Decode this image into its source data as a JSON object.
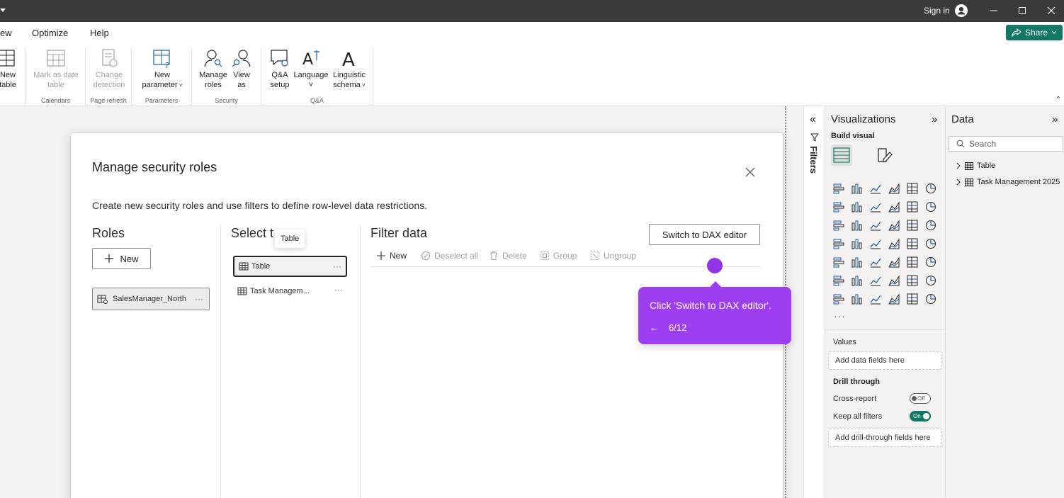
{
  "titlebar": {
    "signin": "Sign in"
  },
  "ribbon": {
    "tabs": [
      "ew",
      "Optimize",
      "Help"
    ],
    "share_label": "Share",
    "groups": {
      "calc": {
        "new_table": [
          "New",
          "table"
        ]
      },
      "calendars": {
        "mark_date": [
          "Mark as date",
          "table"
        ],
        "label": "Calendars"
      },
      "page_refresh": {
        "change_detection": [
          "Change",
          "detection"
        ],
        "label": "Page refresh"
      },
      "parameters": {
        "new_parameter": [
          "New",
          "parameter"
        ],
        "label": "Parameters"
      },
      "security": {
        "manage_roles": [
          "Manage",
          "roles"
        ],
        "view_as": [
          "View",
          "as"
        ],
        "label": "Security"
      },
      "qa": {
        "qa_setup": [
          "Q&A",
          "setup"
        ],
        "language": [
          "Language",
          "˅"
        ],
        "linguistic": [
          "Linguistic",
          "schema"
        ],
        "label": "Q&A"
      }
    }
  },
  "modal": {
    "title": "Manage security roles",
    "description": "Create new security roles and use filters to define row-level data restrictions.",
    "roles_title": "Roles",
    "new_label": "New",
    "roles": [
      {
        "name": "SalesManager_North"
      }
    ],
    "select_table_title": "Select t",
    "tooltip": "Table",
    "tables": [
      {
        "name": "Table"
      },
      {
        "name": "Task Managem..."
      }
    ],
    "filter_title": "Filter data",
    "dax_button": "Switch to DAX editor",
    "filter_toolbar": {
      "new": "New",
      "deselect_all": "Deselect all",
      "delete": "Delete",
      "group": "Group",
      "ungroup": "Ungroup"
    },
    "more": "···"
  },
  "guide": {
    "text": "Click 'Switch to DAX editor'.",
    "back": "←",
    "step": "6/12"
  },
  "filters_pane": {
    "label": "Filters"
  },
  "visualizations": {
    "title": "Visualizations",
    "build_visual": "Build visual",
    "more": "···",
    "values_label": "Values",
    "values_well": "Add data fields here",
    "drill_through": "Drill through",
    "cross_report": "Cross-report",
    "cross_report_state": "Off",
    "keep_all_filters": "Keep all filters",
    "keep_all_filters_state": "On",
    "drill_well": "Add drill-through fields here",
    "colors": {
      "toggle_on": "#117865"
    }
  },
  "data_pane": {
    "title": "Data",
    "search_placeholder": "Search",
    "items": [
      {
        "name": "Table"
      },
      {
        "name": "Task Management 2025"
      }
    ]
  },
  "colors": {
    "accent": "#117865",
    "guide": "#9d3ef0",
    "titlebar": "#3b3a39"
  }
}
